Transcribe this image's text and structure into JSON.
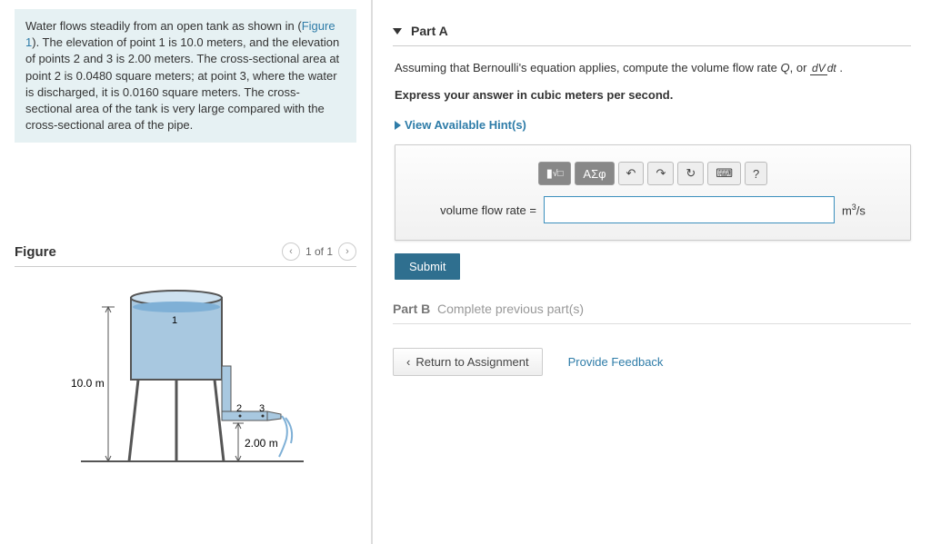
{
  "problem_text_a": "Water flows steadily from an open tank as shown in (",
  "figure_link": "Figure 1",
  "problem_text_b": "). The elevation of point 1 is 10.0 meters, and the elevation of points 2 and 3 is 2.00 meters. The cross-sectional area at point 2 is 0.0480 square meters; at point 3, where the water is discharged, it is 0.0160 square meters. The cross-sectional area of the tank is very large compared with the cross-sectional area of the pipe.",
  "figure": {
    "title": "Figure",
    "counter": "1 of 1",
    "label_h1": "10.0 m",
    "label_h2": "2.00 m",
    "pt1": "1",
    "pt2": "2",
    "pt3": "3"
  },
  "partA": {
    "heading": "Part A",
    "prompt_prefix": "Assuming that Bernoulli's equation applies, compute the volume flow rate ",
    "Q": "Q",
    "or": ", or ",
    "frac_num": "dV",
    "frac_den": "dt",
    "prompt_suffix": " .",
    "express": "Express your answer in cubic meters per second.",
    "hint": "View Available Hint(s)",
    "tool_greek": "ΑΣφ",
    "tool_sqrt": "x",
    "label": "volume flow rate =",
    "unit_html": "m³/s",
    "submit": "Submit",
    "help": "?"
  },
  "partB": {
    "label": "Part B",
    "msg": "Complete previous part(s)"
  },
  "footer": {
    "return": "Return to Assignment",
    "feedback": "Provide Feedback"
  }
}
